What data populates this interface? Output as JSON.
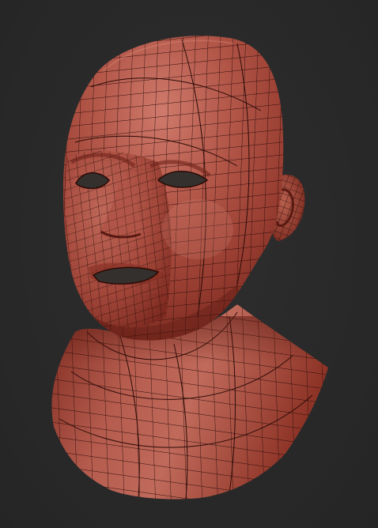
{
  "scene": {
    "subject": "head-bust",
    "background_color": "#2a2a2a",
    "material_color": "#a8473a",
    "material_highlight": "#cf7a6c",
    "material_shadow": "#6e2219",
    "wire_color": "#2a0b07",
    "cavity_color": "#34302d"
  }
}
